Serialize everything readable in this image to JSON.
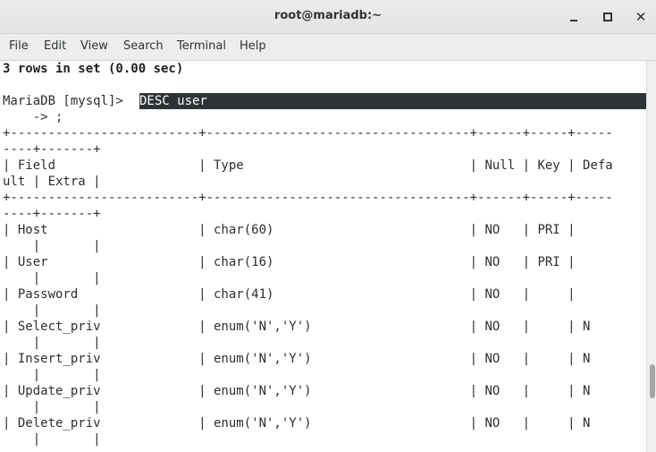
{
  "window": {
    "title": "root@mariadb:~",
    "minimize_icon": "minimize-icon",
    "maximize_icon": "maximize-icon",
    "close_glyph": "✕"
  },
  "menu": [
    "File",
    "Edit",
    "View",
    "Search",
    "Terminal",
    "Help"
  ],
  "terminal": {
    "result_line": "3 rows in set (0.00 sec)",
    "prompt": "MariaDB [mysql]> ",
    "command": "DESC user",
    "continuation": "    -> ;",
    "separator_a": "+-------------------------+-----------------------------------+------+-----+-----",
    "separator_b": "----+-------+",
    "header_a": "| Field                   | Type                              | Null | Key | Defa",
    "header_b": "ult | Extra |",
    "rows": [
      {
        "a": "| Host                    | char(60)                          | NO   | PRI |     ",
        "b": "    |       |"
      },
      {
        "a": "| User                    | char(16)                          | NO   | PRI |     ",
        "b": "    |       |"
      },
      {
        "a": "| Password                | char(41)                          | NO   |     |     ",
        "b": "    |       |"
      },
      {
        "a": "| Select_priv             | enum('N','Y')                     | NO   |     | N   ",
        "b": "    |       |"
      },
      {
        "a": "| Insert_priv             | enum('N','Y')                     | NO   |     | N   ",
        "b": "    |       |"
      },
      {
        "a": "| Update_priv             | enum('N','Y')                     | NO   |     | N   ",
        "b": "    |       |"
      },
      {
        "a": "| Delete_priv             | enum('N','Y')                     | NO   |     | N   ",
        "b": "    |       |"
      }
    ]
  }
}
